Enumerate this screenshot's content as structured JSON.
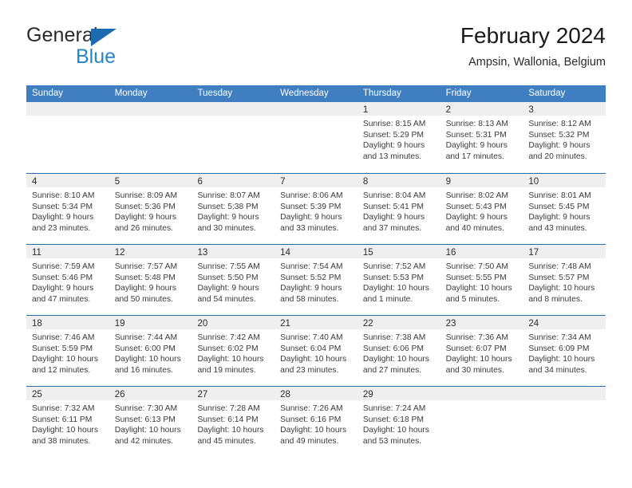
{
  "brand": {
    "name_part1": "General",
    "name_part2": "Blue",
    "triangle_icon": "blue-triangle-icon",
    "color_dark": "#2b2b2b",
    "color_blue": "#2585c7"
  },
  "header": {
    "title": "February 2024",
    "subtitle": "Ampsin, Wallonia, Belgium"
  },
  "theme": {
    "header_bg": "#3f7fc1",
    "row_divider": "#2e6ca8",
    "daynum_band": "#efefef"
  },
  "weekdays": [
    "Sunday",
    "Monday",
    "Tuesday",
    "Wednesday",
    "Thursday",
    "Friday",
    "Saturday"
  ],
  "weeks": [
    [
      {
        "day": "",
        "sunrise": "",
        "sunset": "",
        "daylight1": "",
        "daylight2": ""
      },
      {
        "day": "",
        "sunrise": "",
        "sunset": "",
        "daylight1": "",
        "daylight2": ""
      },
      {
        "day": "",
        "sunrise": "",
        "sunset": "",
        "daylight1": "",
        "daylight2": ""
      },
      {
        "day": "",
        "sunrise": "",
        "sunset": "",
        "daylight1": "",
        "daylight2": ""
      },
      {
        "day": "1",
        "sunrise": "Sunrise: 8:15 AM",
        "sunset": "Sunset: 5:29 PM",
        "daylight1": "Daylight: 9 hours",
        "daylight2": "and 13 minutes."
      },
      {
        "day": "2",
        "sunrise": "Sunrise: 8:13 AM",
        "sunset": "Sunset: 5:31 PM",
        "daylight1": "Daylight: 9 hours",
        "daylight2": "and 17 minutes."
      },
      {
        "day": "3",
        "sunrise": "Sunrise: 8:12 AM",
        "sunset": "Sunset: 5:32 PM",
        "daylight1": "Daylight: 9 hours",
        "daylight2": "and 20 minutes."
      }
    ],
    [
      {
        "day": "4",
        "sunrise": "Sunrise: 8:10 AM",
        "sunset": "Sunset: 5:34 PM",
        "daylight1": "Daylight: 9 hours",
        "daylight2": "and 23 minutes."
      },
      {
        "day": "5",
        "sunrise": "Sunrise: 8:09 AM",
        "sunset": "Sunset: 5:36 PM",
        "daylight1": "Daylight: 9 hours",
        "daylight2": "and 26 minutes."
      },
      {
        "day": "6",
        "sunrise": "Sunrise: 8:07 AM",
        "sunset": "Sunset: 5:38 PM",
        "daylight1": "Daylight: 9 hours",
        "daylight2": "and 30 minutes."
      },
      {
        "day": "7",
        "sunrise": "Sunrise: 8:06 AM",
        "sunset": "Sunset: 5:39 PM",
        "daylight1": "Daylight: 9 hours",
        "daylight2": "and 33 minutes."
      },
      {
        "day": "8",
        "sunrise": "Sunrise: 8:04 AM",
        "sunset": "Sunset: 5:41 PM",
        "daylight1": "Daylight: 9 hours",
        "daylight2": "and 37 minutes."
      },
      {
        "day": "9",
        "sunrise": "Sunrise: 8:02 AM",
        "sunset": "Sunset: 5:43 PM",
        "daylight1": "Daylight: 9 hours",
        "daylight2": "and 40 minutes."
      },
      {
        "day": "10",
        "sunrise": "Sunrise: 8:01 AM",
        "sunset": "Sunset: 5:45 PM",
        "daylight1": "Daylight: 9 hours",
        "daylight2": "and 43 minutes."
      }
    ],
    [
      {
        "day": "11",
        "sunrise": "Sunrise: 7:59 AM",
        "sunset": "Sunset: 5:46 PM",
        "daylight1": "Daylight: 9 hours",
        "daylight2": "and 47 minutes."
      },
      {
        "day": "12",
        "sunrise": "Sunrise: 7:57 AM",
        "sunset": "Sunset: 5:48 PM",
        "daylight1": "Daylight: 9 hours",
        "daylight2": "and 50 minutes."
      },
      {
        "day": "13",
        "sunrise": "Sunrise: 7:55 AM",
        "sunset": "Sunset: 5:50 PM",
        "daylight1": "Daylight: 9 hours",
        "daylight2": "and 54 minutes."
      },
      {
        "day": "14",
        "sunrise": "Sunrise: 7:54 AM",
        "sunset": "Sunset: 5:52 PM",
        "daylight1": "Daylight: 9 hours",
        "daylight2": "and 58 minutes."
      },
      {
        "day": "15",
        "sunrise": "Sunrise: 7:52 AM",
        "sunset": "Sunset: 5:53 PM",
        "daylight1": "Daylight: 10 hours",
        "daylight2": "and 1 minute."
      },
      {
        "day": "16",
        "sunrise": "Sunrise: 7:50 AM",
        "sunset": "Sunset: 5:55 PM",
        "daylight1": "Daylight: 10 hours",
        "daylight2": "and 5 minutes."
      },
      {
        "day": "17",
        "sunrise": "Sunrise: 7:48 AM",
        "sunset": "Sunset: 5:57 PM",
        "daylight1": "Daylight: 10 hours",
        "daylight2": "and 8 minutes."
      }
    ],
    [
      {
        "day": "18",
        "sunrise": "Sunrise: 7:46 AM",
        "sunset": "Sunset: 5:59 PM",
        "daylight1": "Daylight: 10 hours",
        "daylight2": "and 12 minutes."
      },
      {
        "day": "19",
        "sunrise": "Sunrise: 7:44 AM",
        "sunset": "Sunset: 6:00 PM",
        "daylight1": "Daylight: 10 hours",
        "daylight2": "and 16 minutes."
      },
      {
        "day": "20",
        "sunrise": "Sunrise: 7:42 AM",
        "sunset": "Sunset: 6:02 PM",
        "daylight1": "Daylight: 10 hours",
        "daylight2": "and 19 minutes."
      },
      {
        "day": "21",
        "sunrise": "Sunrise: 7:40 AM",
        "sunset": "Sunset: 6:04 PM",
        "daylight1": "Daylight: 10 hours",
        "daylight2": "and 23 minutes."
      },
      {
        "day": "22",
        "sunrise": "Sunrise: 7:38 AM",
        "sunset": "Sunset: 6:06 PM",
        "daylight1": "Daylight: 10 hours",
        "daylight2": "and 27 minutes."
      },
      {
        "day": "23",
        "sunrise": "Sunrise: 7:36 AM",
        "sunset": "Sunset: 6:07 PM",
        "daylight1": "Daylight: 10 hours",
        "daylight2": "and 30 minutes."
      },
      {
        "day": "24",
        "sunrise": "Sunrise: 7:34 AM",
        "sunset": "Sunset: 6:09 PM",
        "daylight1": "Daylight: 10 hours",
        "daylight2": "and 34 minutes."
      }
    ],
    [
      {
        "day": "25",
        "sunrise": "Sunrise: 7:32 AM",
        "sunset": "Sunset: 6:11 PM",
        "daylight1": "Daylight: 10 hours",
        "daylight2": "and 38 minutes."
      },
      {
        "day": "26",
        "sunrise": "Sunrise: 7:30 AM",
        "sunset": "Sunset: 6:13 PM",
        "daylight1": "Daylight: 10 hours",
        "daylight2": "and 42 minutes."
      },
      {
        "day": "27",
        "sunrise": "Sunrise: 7:28 AM",
        "sunset": "Sunset: 6:14 PM",
        "daylight1": "Daylight: 10 hours",
        "daylight2": "and 45 minutes."
      },
      {
        "day": "28",
        "sunrise": "Sunrise: 7:26 AM",
        "sunset": "Sunset: 6:16 PM",
        "daylight1": "Daylight: 10 hours",
        "daylight2": "and 49 minutes."
      },
      {
        "day": "29",
        "sunrise": "Sunrise: 7:24 AM",
        "sunset": "Sunset: 6:18 PM",
        "daylight1": "Daylight: 10 hours",
        "daylight2": "and 53 minutes."
      },
      {
        "day": "",
        "sunrise": "",
        "sunset": "",
        "daylight1": "",
        "daylight2": ""
      },
      {
        "day": "",
        "sunrise": "",
        "sunset": "",
        "daylight1": "",
        "daylight2": ""
      }
    ]
  ]
}
